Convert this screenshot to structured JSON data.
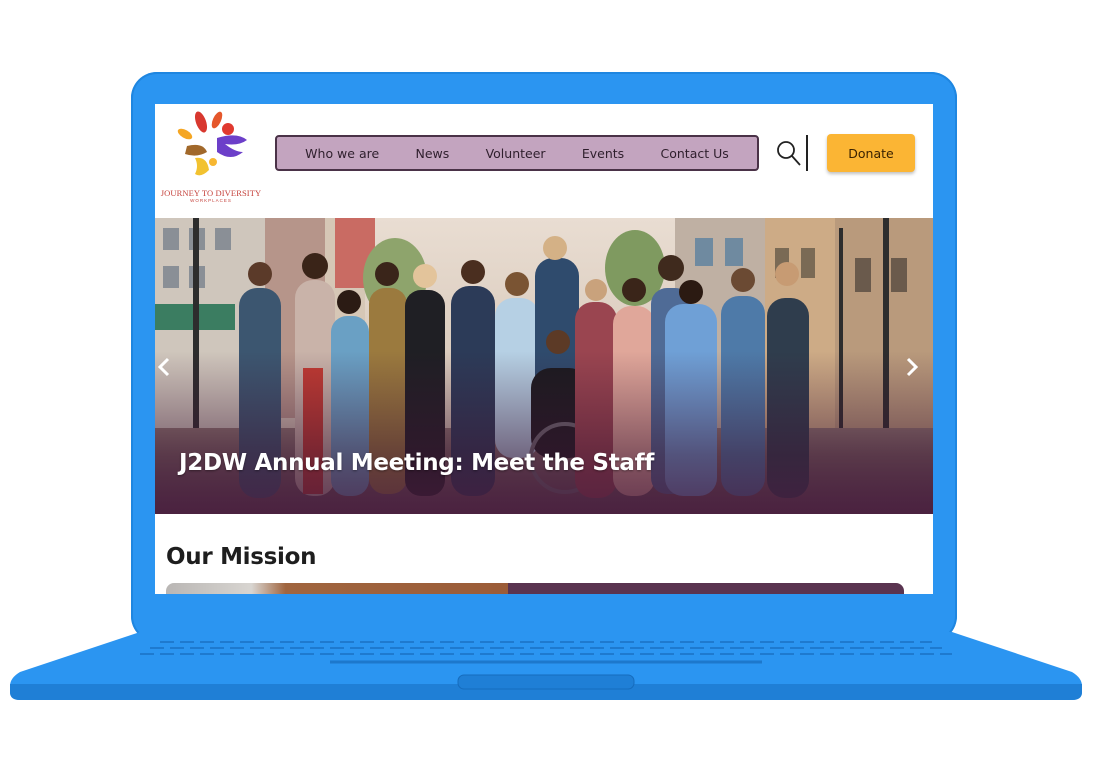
{
  "logo": {
    "title": "JOURNEY TO DIVERSITY",
    "subtitle": "WORKPLACES"
  },
  "nav": {
    "items": [
      {
        "label": "Who we are"
      },
      {
        "label": "News"
      },
      {
        "label": "Volunteer"
      },
      {
        "label": "Events"
      },
      {
        "label": "Contact Us"
      }
    ]
  },
  "header": {
    "search_icon": "search-icon",
    "donate_label": "Donate"
  },
  "hero": {
    "caption": "J2DW Annual Meeting: Meet the Staff",
    "prev_icon": "chevron-left-icon",
    "next_icon": "chevron-right-icon"
  },
  "mission": {
    "title": "Our Mission"
  },
  "colors": {
    "laptop": "#2b95f1",
    "nav_bg": "#c3a4bf",
    "nav_border": "#4a3247",
    "donate": "#fbb534",
    "mission_panel": "#5a3450"
  }
}
